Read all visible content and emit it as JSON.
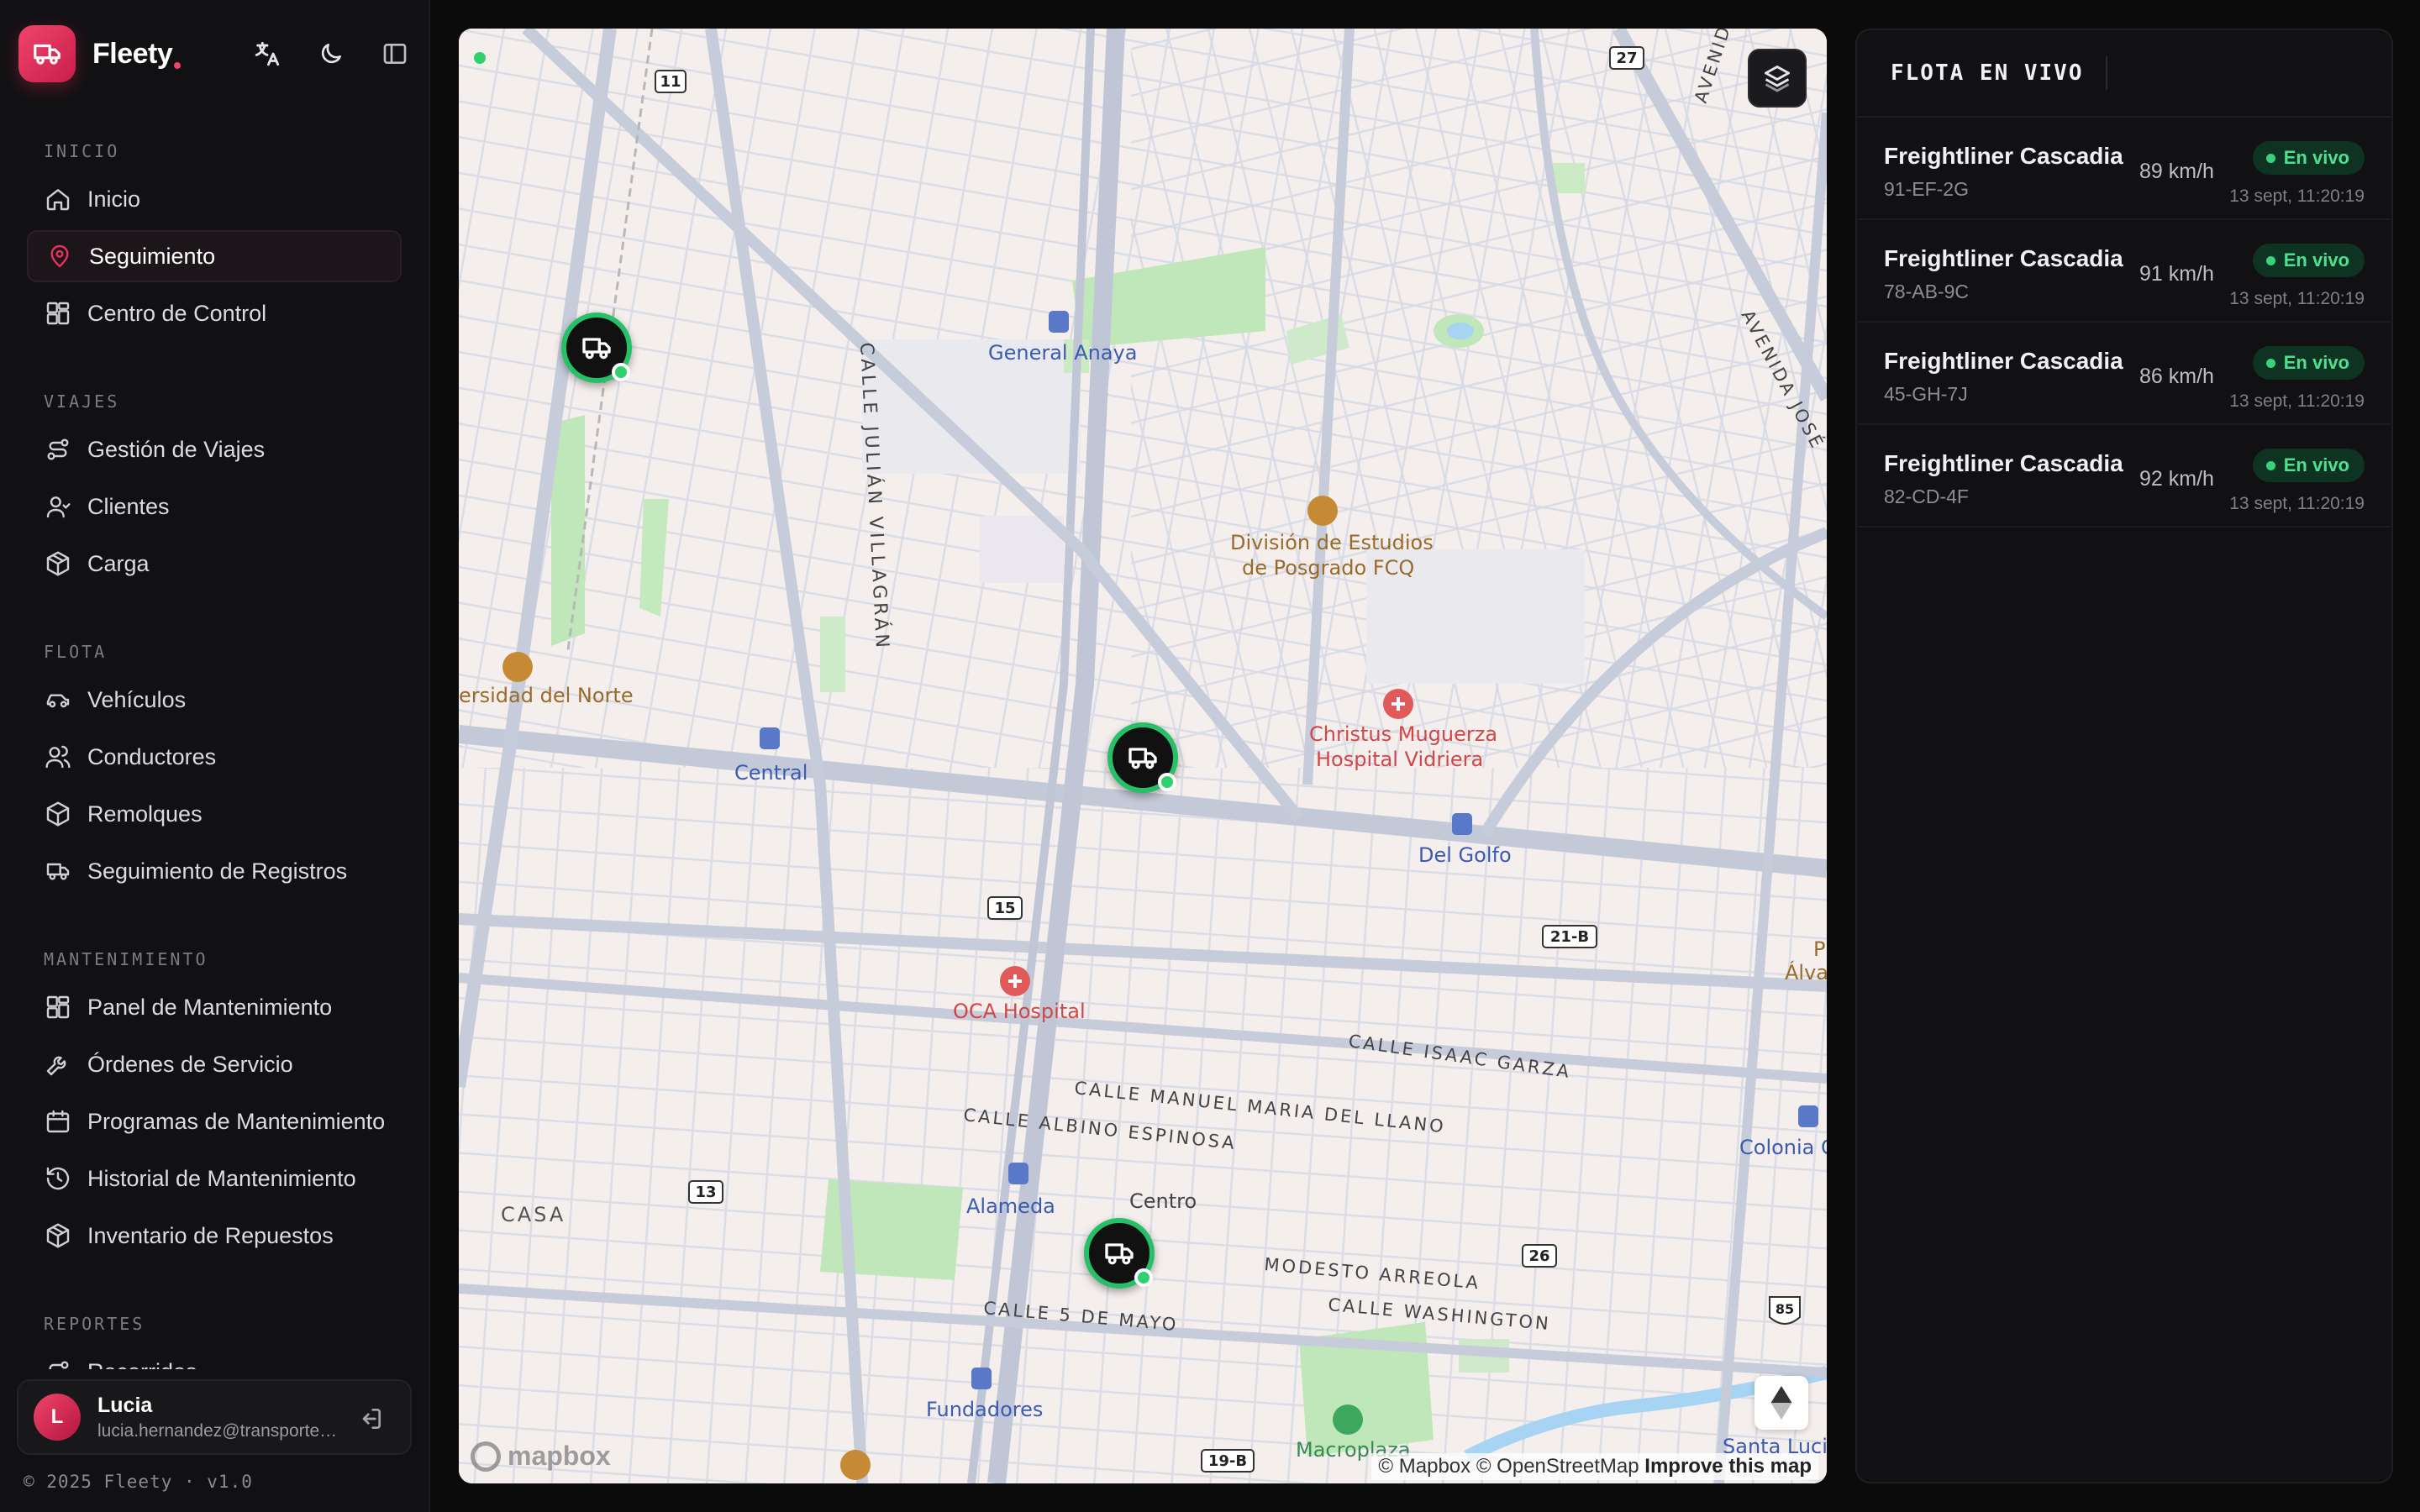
{
  "app": {
    "name": "Fleety"
  },
  "sidebar": {
    "sections": [
      {
        "title": "INICIO",
        "items": [
          {
            "label": "Inicio",
            "icon": "home-icon",
            "active": false
          },
          {
            "label": "Seguimiento",
            "icon": "map-pin-icon",
            "active": true
          },
          {
            "label": "Centro de Control",
            "icon": "dashboard-icon",
            "active": false
          }
        ]
      },
      {
        "title": "VIAJES",
        "items": [
          {
            "label": "Gestión de Viajes",
            "icon": "route-icon",
            "active": false
          },
          {
            "label": "Clientes",
            "icon": "user-icon",
            "active": false
          },
          {
            "label": "Carga",
            "icon": "package-icon",
            "active": false
          }
        ]
      },
      {
        "title": "FLOTA",
        "items": [
          {
            "label": "Vehículos",
            "icon": "car-icon",
            "active": false
          },
          {
            "label": "Conductores",
            "icon": "users-icon",
            "active": false
          },
          {
            "label": "Remolques",
            "icon": "box-icon",
            "active": false
          },
          {
            "label": "Seguimiento de Registros",
            "icon": "truck-icon",
            "active": false
          }
        ]
      },
      {
        "title": "MANTENIMIENTO",
        "items": [
          {
            "label": "Panel de Mantenimiento",
            "icon": "dashboard-icon",
            "active": false
          },
          {
            "label": "Órdenes de Servicio",
            "icon": "wrench-icon",
            "active": false
          },
          {
            "label": "Programas de Mantenimiento",
            "icon": "calendar-icon",
            "active": false
          },
          {
            "label": "Historial de Mantenimiento",
            "icon": "history-icon",
            "active": false
          },
          {
            "label": "Inventario de Repuestos",
            "icon": "package-icon",
            "active": false
          }
        ]
      },
      {
        "title": "REPORTES",
        "items": [
          {
            "label": "Recorridos",
            "icon": "route-icon",
            "active": false
          }
        ]
      }
    ],
    "user": {
      "initial": "L",
      "name": "Lucia",
      "email": "lucia.hernandez@transportes..."
    },
    "footer": "© 2025 Fleety · v1.0"
  },
  "map": {
    "labels": {
      "general_anaya": "General Anaya",
      "calle_julian": "CALLE JULIÁN VILLAGRÁN",
      "division1": "División de Estudios",
      "division2": "de Posgrado FCQ",
      "univ_norte": "ersidad del Norte",
      "central": "Central",
      "christus1": "Christus Muguerza",
      "christus2": "Hospital Vidriera",
      "del_golfo": "Del Golfo",
      "oca": "OCA Hospital",
      "isaac": "CALLE ISAAC GARZA",
      "manuel": "CALLE MANUEL MARIA DEL LLANO",
      "albino": "CALLE ALBINO ESPINOSA",
      "alameda": "Alameda",
      "centro": "Centro",
      "colonia": "Colonia C",
      "casa": "CASA",
      "modesto": "MODESTO ARREOLA",
      "washington": "CALLE WASHINGTON",
      "cinco_mayo": "CALLE 5 DE MAYO",
      "fundadores": "Fundadores",
      "macroplaza": "Macroplaza",
      "santa_lucia": "Santa Lucia",
      "avenida1": "AVENIDA",
      "avenida_jose": "AVENIDA JOSÉ",
      "alva": "Álva",
      "p": "P"
    },
    "shields": [
      "11",
      "27",
      "15",
      "21-B",
      "13",
      "26",
      "19-B",
      "85"
    ],
    "attribution": {
      "mapbox": "© Mapbox",
      "osm": "© OpenStreetMap",
      "improve": "Improve this map"
    },
    "logo": "mapbox",
    "live_text": "En vivo"
  },
  "fleet": {
    "title": "FLOTA EN VIVO",
    "vehicles": [
      {
        "name": "Freightliner Cascadia",
        "plate": "91-EF-2G",
        "speed": "89 km/h",
        "status": "En vivo",
        "time": "13 sept, 11:20:19"
      },
      {
        "name": "Freightliner Cascadia",
        "plate": "78-AB-9C",
        "speed": "91 km/h",
        "status": "En vivo",
        "time": "13 sept, 11:20:19"
      },
      {
        "name": "Freightliner Cascadia",
        "plate": "45-GH-7J",
        "speed": "86 km/h",
        "status": "En vivo",
        "time": "13 sept, 11:20:19"
      },
      {
        "name": "Freightliner Cascadia",
        "plate": "82-CD-4F",
        "speed": "92 km/h",
        "status": "En vivo",
        "time": "13 sept, 11:20:19"
      }
    ]
  },
  "colors": {
    "accent": "#e8325e",
    "live": "#2fd16f",
    "map_bg": "#f4efed"
  }
}
